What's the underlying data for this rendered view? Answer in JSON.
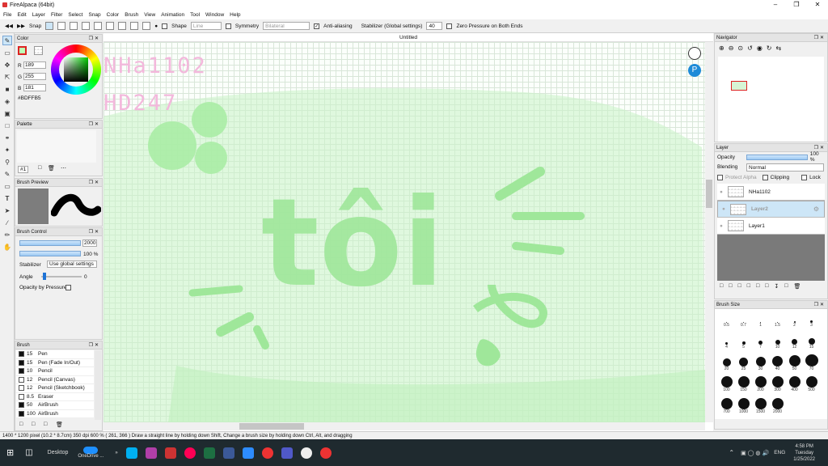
{
  "window": {
    "title": "FireAlpaca (64bit)"
  },
  "menu": [
    "File",
    "Edit",
    "Layer",
    "Filter",
    "Select",
    "Snap",
    "Color",
    "Brush",
    "View",
    "Animation",
    "Tool",
    "Window",
    "Help"
  ],
  "toolbar": {
    "snap_label": "Snap",
    "shape_label": "Shape",
    "shape_value": "Line",
    "symmetry_label": "Symmetry",
    "symmetry_value": "Bilateral",
    "antialias_label": "Anti-aliasing",
    "stabilizer_label": "Stabilizer (Global settings)",
    "stabilizer_value": "40",
    "zero_pressure_label": "Zero Pressure on Both Ends"
  },
  "color_panel": {
    "title": "Color",
    "r_label": "R",
    "r": "189",
    "g_label": "G",
    "g": "255",
    "b_label": "B",
    "b": "181",
    "hex": "#BDFFB5",
    "main_color": "#bdffb5"
  },
  "palette_panel": {
    "title": "Palette",
    "num": "#1"
  },
  "brush_preview": {
    "title": "Brush Preview"
  },
  "brush_control": {
    "title": "Brush Control",
    "size": "2000",
    "opacity": "100 %",
    "stabilizer_label": "Stabilizer",
    "stabilizer_value": "Use global settings",
    "angle_label": "Angle",
    "angle_value": "0",
    "opacity_pressure_label": "Opacity by Pressure"
  },
  "brush_list": {
    "title": "Brush",
    "items": [
      {
        "size": "15",
        "name": "Pen"
      },
      {
        "size": "15",
        "name": "Pen (Fade In/Out)"
      },
      {
        "size": "10",
        "name": "Pencil"
      },
      {
        "size": "12",
        "name": "Pencil (Canvas)"
      },
      {
        "size": "12",
        "name": "Pencil (Sketchbook)"
      },
      {
        "size": "8.5",
        "name": "Eraser"
      },
      {
        "size": "50",
        "name": "AirBrush"
      },
      {
        "size": "100",
        "name": "AirBrush"
      }
    ]
  },
  "canvas": {
    "doc_title": "Untitled",
    "watermark_1": "NHa1102",
    "watermark_2": "HD247",
    "art_text": "tôi"
  },
  "navigator": {
    "title": "Navigator"
  },
  "layer_panel": {
    "title": "Layer",
    "opacity_label": "Opacity",
    "opacity_value": "100 %",
    "blending_label": "Blending",
    "blending_value": "Normal",
    "protect_alpha": "Protect Alpha",
    "clipping": "Clipping",
    "lock": "Lock",
    "layers": [
      {
        "name": "NHa1102"
      },
      {
        "name": "Layer2"
      },
      {
        "name": "Layer1"
      }
    ]
  },
  "brush_size": {
    "title": "Brush Size",
    "sizes": [
      "0.5",
      "0.7",
      "1",
      "1.5",
      "2",
      "3",
      "4",
      "5",
      "7",
      "10",
      "12",
      "15",
      "20",
      "25",
      "30",
      "40",
      "50",
      "70",
      "100",
      "150",
      "200",
      "300",
      "400",
      "500",
      "700",
      "1000",
      "1500",
      "2000"
    ]
  },
  "status": {
    "text": "1400 * 1200 pixel   (10.2 * 8.7cm)   350 dpi   600 %   ( 261, 366 )   Draw a straight line by holding down Shift, Change a brush size by holding down Ctrl, Alt, and dragging"
  },
  "taskbar": {
    "desktop_label": "Desktop",
    "onedrive_label": "OneDrive ...",
    "lang": "ENG",
    "time": "4:58 PM",
    "day": "Tuesday",
    "date": "1/25/2022"
  }
}
